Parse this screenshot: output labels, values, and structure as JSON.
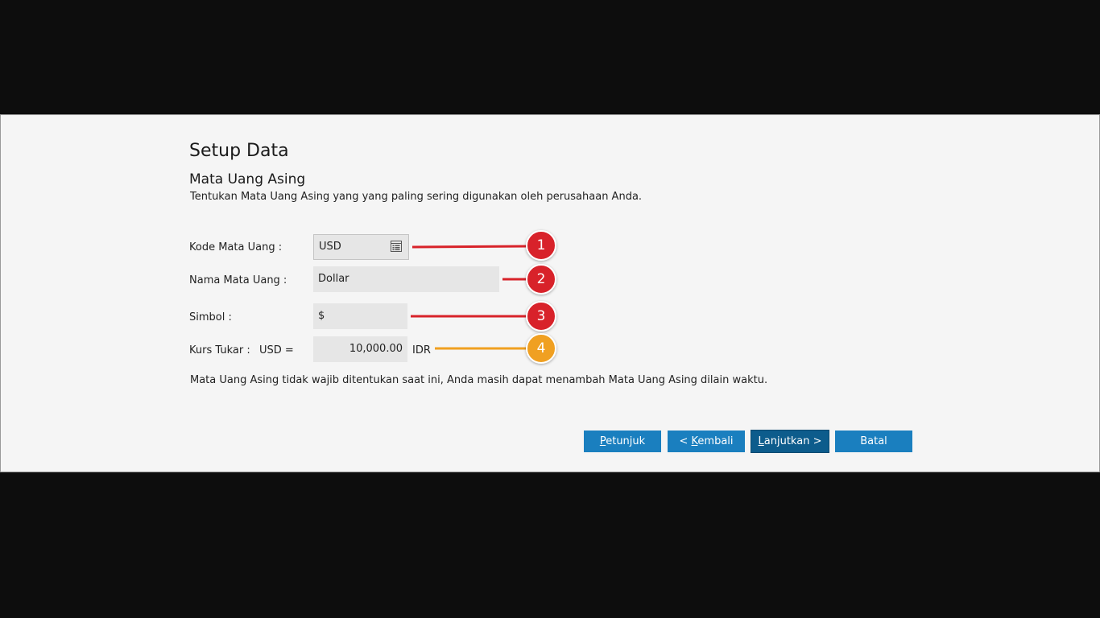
{
  "dialog": {
    "title": "Setup Data",
    "subtitle": "Mata Uang Asing",
    "description": "Tentukan Mata Uang Asing yang yang paling sering digunakan oleh perusahaan Anda."
  },
  "form": {
    "currency_code_label": "Kode Mata Uang :",
    "currency_code_value": "USD",
    "currency_name_label": "Nama Mata Uang :",
    "currency_name_value": "Dollar",
    "symbol_label": "Simbol :",
    "symbol_value": "$",
    "rate_label": "Kurs Tukar :",
    "rate_currency": "USD =",
    "rate_value": "10,000.00",
    "rate_unit": "IDR"
  },
  "note": "Mata Uang Asing tidak wajib ditentukan saat ini, Anda masih dapat menambah Mata Uang Asing dilain waktu.",
  "buttons": {
    "help_key": "P",
    "help_rest": "etunjuk",
    "back_prefix": "< ",
    "back_key": "K",
    "back_rest": "embali",
    "next_key": "L",
    "next_rest": "anjutkan >",
    "cancel": "Batal"
  },
  "callouts": [
    "1",
    "2",
    "3",
    "4"
  ],
  "colors": {
    "callout_red": "#d8232a",
    "callout_orange": "#f0a020",
    "button_blue": "#1a7fbf",
    "button_primary": "#0d5c8c"
  },
  "icons": {
    "currency_picker": "list-picker-icon"
  }
}
